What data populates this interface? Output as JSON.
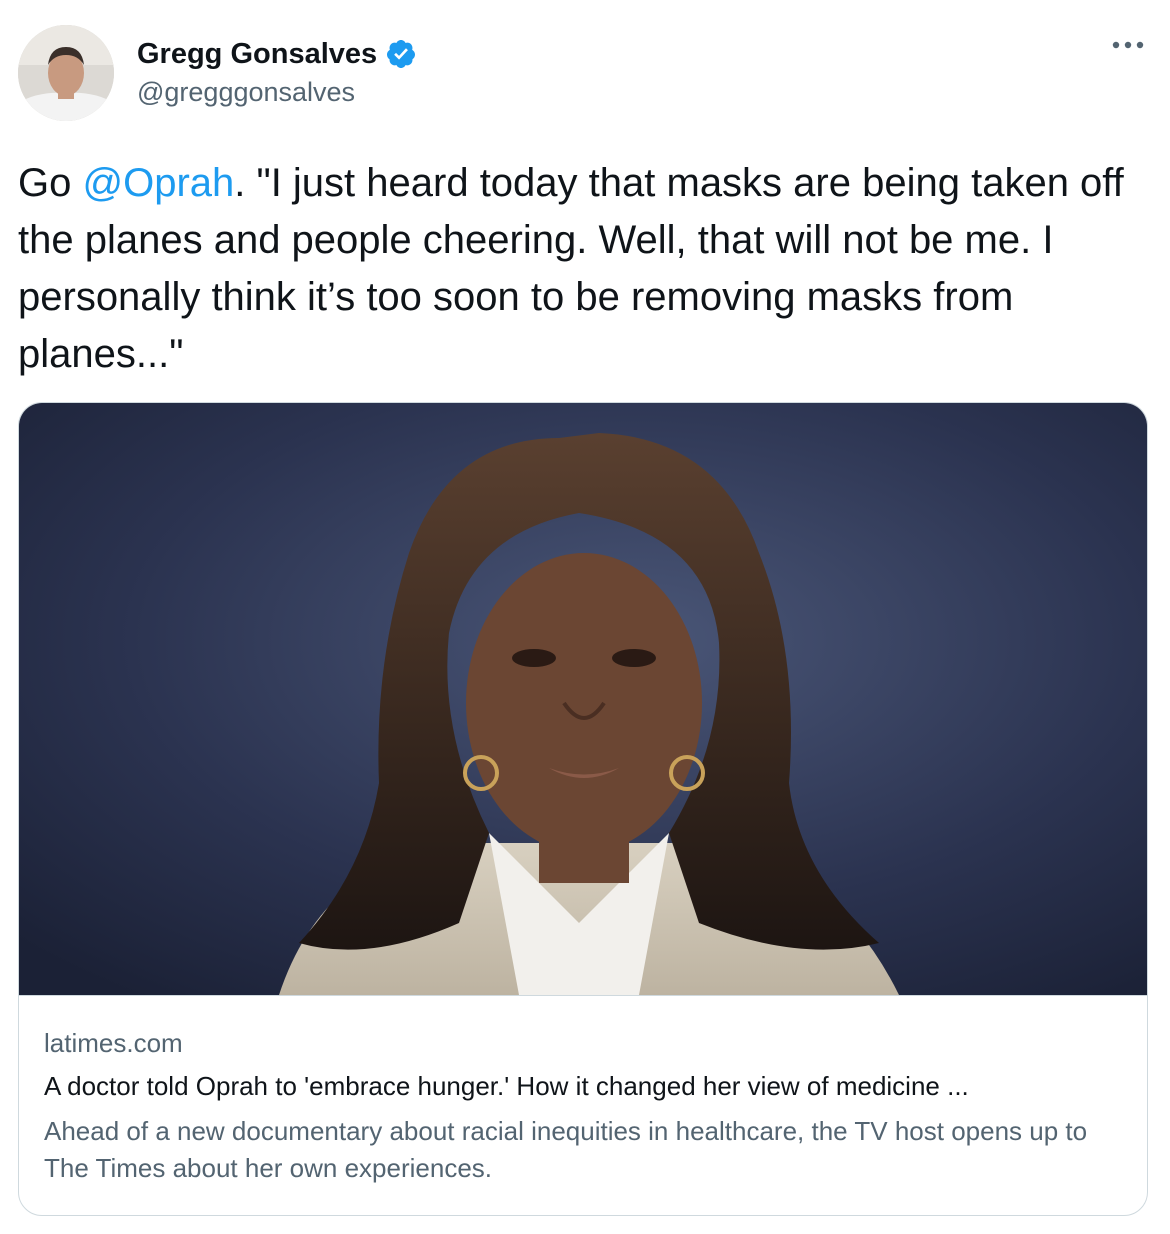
{
  "author": {
    "name": "Gregg Gonsalves",
    "handle": "@gregggonsalves",
    "verified": true,
    "avatar_icon": "profile-photo"
  },
  "more_icon": "ellipsis-icon",
  "tweet": {
    "prefix": "Go ",
    "mention": "@Oprah",
    "body": ". \"I just heard today that masks are being taken off the planes and people cheering. Well, that will not be me. I personally think it’s too soon to be removing masks from planes...\""
  },
  "link_card": {
    "domain": "latimes.com",
    "title": "A doctor told Oprah to 'embrace hunger.' How it changed her view of medicine ...",
    "description": "Ahead of a new documentary about racial inequities in healthcare, the TV host opens up to The Times about her own experiences.",
    "image_icon": "portrait-photo"
  },
  "colors": {
    "text": "#0f1419",
    "secondary": "#536471",
    "link": "#1d9bf0",
    "border": "#cfd9de",
    "verified": "#1d9bf0"
  }
}
